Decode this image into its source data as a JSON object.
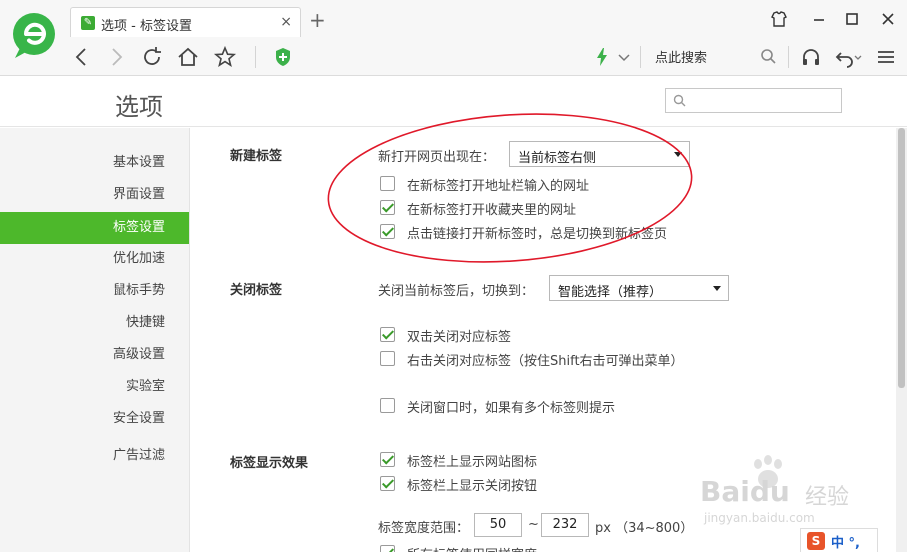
{
  "browser": {
    "tab_title": "选项 - 标签设置",
    "tab_close": "×",
    "new_tab": "+",
    "search_engine_label": "点此搜索",
    "icons": [
      "back-icon",
      "forward-icon",
      "refresh-icon",
      "home-icon",
      "star-icon",
      "shield-plus-icon",
      "lightning-icon",
      "search-icon",
      "headphones-icon",
      "undo-icon",
      "menu-icon",
      "skin-icon",
      "minimize-icon",
      "maximize-icon",
      "close-icon"
    ]
  },
  "header": {
    "title": "选项",
    "search_placeholder": ""
  },
  "sidebar": {
    "items": [
      {
        "label": "基本设置"
      },
      {
        "label": "界面设置"
      },
      {
        "label": "标签设置",
        "active": true
      },
      {
        "label": "优化加速"
      },
      {
        "label": "鼠标手势"
      },
      {
        "label": "快捷键"
      },
      {
        "label": "高级设置"
      },
      {
        "label": "实验室"
      },
      {
        "label": "安全设置"
      },
      {
        "label": "广告过滤"
      }
    ]
  },
  "sections": {
    "new_tab": {
      "title": "新建标签",
      "open_position_label": "新打开网页出现在：",
      "open_position_value": "当前标签右侧",
      "options": [
        {
          "label": "在新标签打开地址栏输入的网址",
          "checked": false
        },
        {
          "label": "在新标签打开收藏夹里的网址",
          "checked": true
        },
        {
          "label": "点击链接打开新标签时，总是切换到新标签页",
          "checked": true
        }
      ]
    },
    "close_tab": {
      "title": "关闭标签",
      "switch_label": "关闭当前标签后，切换到：",
      "switch_value": "智能选择（推荐）",
      "options": [
        {
          "label": "双击关闭对应标签",
          "checked": true
        },
        {
          "label": "右击关闭对应标签（按住Shift右击可弹出菜单）",
          "checked": false
        },
        {
          "label": "关闭窗口时，如果有多个标签则提示",
          "checked": false
        }
      ]
    },
    "display": {
      "title": "标签显示效果",
      "options": [
        {
          "label": "标签栏上显示网站图标",
          "checked": true
        },
        {
          "label": "标签栏上显示关闭按钮",
          "checked": true
        }
      ],
      "width_label": "标签宽度范围：",
      "width_min": "50",
      "width_sep": "~",
      "width_max": "232",
      "width_unit": "px （34~800）",
      "partial_option": "所有标签使用同样宽度"
    }
  },
  "watermark": {
    "brand": "Baidu",
    "brand_cn": "经验",
    "url": "jingyan.baidu.com"
  },
  "ime": {
    "logo": "S",
    "text": "中 °,"
  },
  "colors": {
    "accent": "#4db82b",
    "annotation": "#e0192a",
    "check": "#3a9a2a"
  }
}
